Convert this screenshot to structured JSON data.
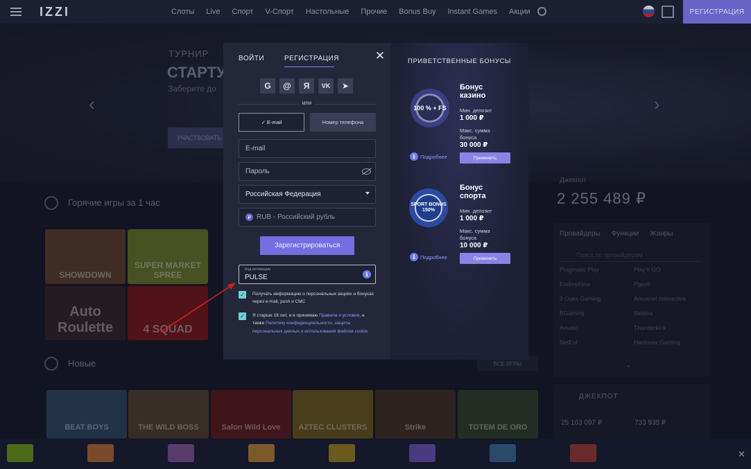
{
  "topbar": {
    "logo": "IZZI",
    "nav": [
      "Слоты",
      "Live",
      "Спорт",
      "V-Спорт",
      "Настольные",
      "Прочие",
      "Bonus Buy",
      "Instant Games",
      "Акции"
    ],
    "register_button": "РЕГИСТРАЦИЯ"
  },
  "banner": {
    "line1": "ТУРНИР",
    "line2": "СТАРТУ",
    "line3": "Заберите до",
    "button": "УЧАСТВОВАТЬ"
  },
  "sections": {
    "hot_title": "Горячие игры за 1 час",
    "new_title": "Новые",
    "all_games": "ВСЕ ИГРЫ"
  },
  "hot_games": [
    {
      "name": "SHOWDOWN",
      "color": "#6b4a2e"
    },
    {
      "name": "SUPER MARKET SPREE",
      "color": "#7a8a2a"
    },
    {
      "name": "Auto Roulette",
      "color": "#3b2a2a"
    },
    {
      "name": "4 SQUAD",
      "color": "#8a1a1a"
    }
  ],
  "new_games": [
    {
      "name": "BEAT BOYS",
      "color": "#33506e"
    },
    {
      "name": "THE WILD BOSS",
      "color": "#5a4a30"
    },
    {
      "name": "Salon Wild Love",
      "color": "#6a1e20"
    },
    {
      "name": "AZTEC CLUSTERS",
      "color": "#7a6420"
    },
    {
      "name": "Strike",
      "color": "#4a3a28"
    },
    {
      "name": "TOTEM DE ORO",
      "color": "#3a4a30"
    }
  ],
  "jackpot": {
    "label": "Джекпот",
    "value": "2 255 489 ₽",
    "title": "ДЖЕКПОТ",
    "v1": "25 163 097 ₽",
    "v2": "733 935 ₽"
  },
  "providers": {
    "tabs": [
      "Провайдеры",
      "Функции",
      "Жанры"
    ],
    "search_placeholder": "Поиск по провайдерам",
    "list": [
      "Pragmatic Play",
      "Play'n GO",
      "Endorphina",
      "Pgsoft",
      "3 Oaks Gaming",
      "Amusnet Interactive",
      "BGaming",
      "Belatra",
      "Amatic",
      "Thunderkick",
      "NetEnt",
      "Hacksaw Gaming"
    ]
  },
  "modal": {
    "tab_login": "ВОЙТИ",
    "tab_register": "РЕГИСТРАЦИЯ",
    "close_symbol": "✕",
    "socials": [
      "G",
      "@",
      "Я",
      "VK",
      "➤"
    ],
    "or": "или",
    "switch_email": "✓ E-mail",
    "switch_phone": "Номер телефона",
    "email_placeholder": "E-mail",
    "password_placeholder": "Пароль",
    "country": "Российская Федерация",
    "currency": "RUB - Российский рубль",
    "submit": "Зарегистрироваться",
    "promo_label": "Код активации",
    "promo_value": "PULSE",
    "consent1": "Получать информацию о персональных акциях и бонусах через e-mail, push и СМС",
    "consent2_a": "Я старше 18 лет, и я принимаю ",
    "consent2_link1": "Правила и условия",
    "consent2_b": ", а также ",
    "consent2_link2": "Политику конфиденциальности, защиты персональных данных и использования файлов cookie"
  },
  "bonuses": {
    "heading": "ПРИВЕТСТВЕННЫЕ БОНУСЫ",
    "casino": {
      "chip": "100 % + FS",
      "title": "Бонус казино",
      "min_label": "Мин. депозит",
      "min_value": "1 000 ₽",
      "max_label": "Макс. сумма бонуса",
      "max_value": "30 000 ₽",
      "more": "Подробнее",
      "apply": "Применить"
    },
    "sport": {
      "chip": "SPORT BONUS 150%",
      "title": "Бонус спорта",
      "min_label": "Мин. депозит",
      "min_value": "1 000 ₽",
      "max_label": "Макс. сумма бонуса",
      "max_value": "10 000 ₽",
      "more": "Подробнее",
      "apply": "Применить"
    }
  },
  "ticker": {
    "items": [
      {
        "color": "#4a6a1a"
      },
      {
        "color": "#7a4a2a"
      },
      {
        "color": "#5a3a6a"
      },
      {
        "color": "#7a5a2a"
      },
      {
        "color": "#6a5a20"
      },
      {
        "color": "#4a3a80"
      },
      {
        "color": "#2a4a6a"
      },
      {
        "color": "#6a2a2a"
      }
    ]
  }
}
